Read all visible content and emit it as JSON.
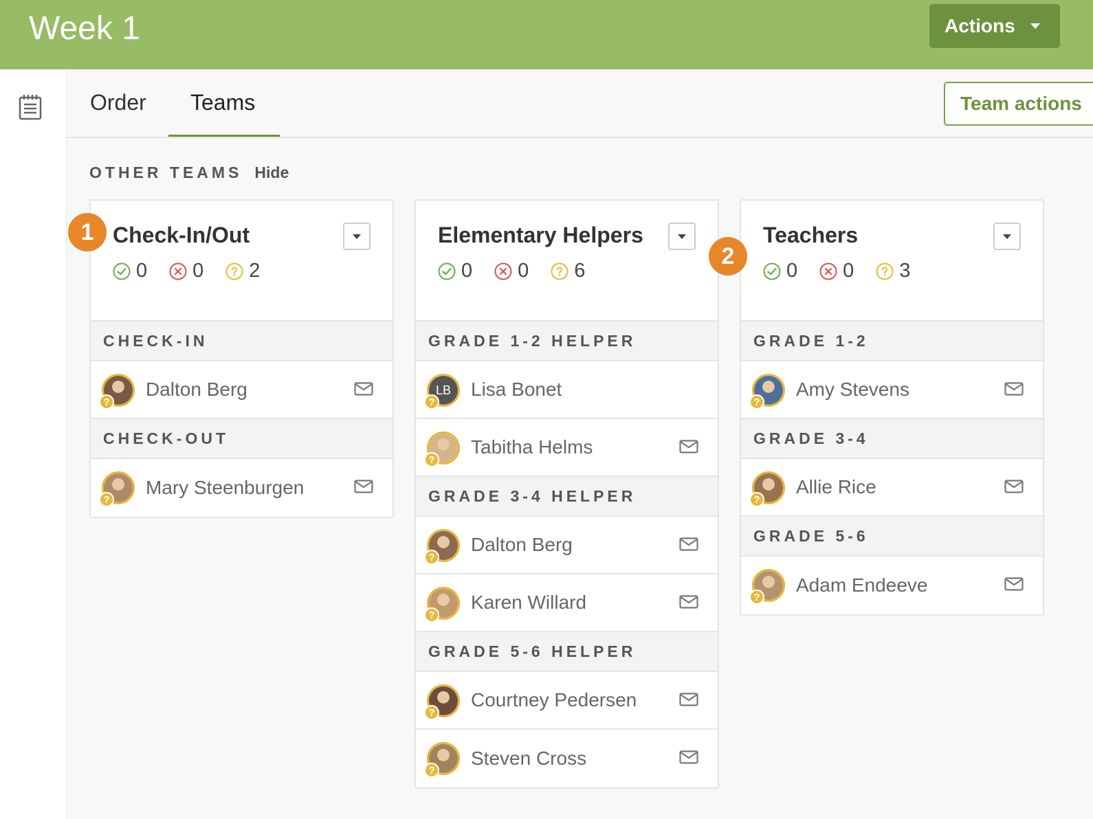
{
  "header": {
    "title": "Week 1",
    "actions_label": "Actions"
  },
  "tabs": [
    {
      "label": "Order"
    },
    {
      "label": "Teams"
    }
  ],
  "team_actions_label": "Team actions",
  "other_teams": {
    "label": "OTHER TEAMS",
    "hide_label": "Hide"
  },
  "step_badges": [
    "1",
    "2"
  ],
  "teams": [
    {
      "name": "Check-In/Out",
      "counts": {
        "accepted": "0",
        "declined": "0",
        "pending": "2"
      },
      "positions": [
        {
          "name": "CHECK-IN",
          "people": [
            {
              "name": "Dalton Berg"
            }
          ]
        },
        {
          "name": "CHECK-OUT",
          "people": [
            {
              "name": "Mary Steenburgen"
            }
          ]
        }
      ]
    },
    {
      "name": "Elementary Helpers",
      "counts": {
        "accepted": "0",
        "declined": "0",
        "pending": "6"
      },
      "positions": [
        {
          "name": "GRADE 1-2 HELPER",
          "people": [
            {
              "name": "Lisa Bonet",
              "initials": "LB"
            },
            {
              "name": "Tabitha Helms"
            }
          ]
        },
        {
          "name": "GRADE 3-4 HELPER",
          "people": [
            {
              "name": "Dalton Berg"
            },
            {
              "name": "Karen Willard"
            }
          ]
        },
        {
          "name": "GRADE 5-6 HELPER",
          "people": [
            {
              "name": "Courtney Pedersen"
            },
            {
              "name": "Steven Cross"
            }
          ]
        }
      ]
    },
    {
      "name": "Teachers",
      "counts": {
        "accepted": "0",
        "declined": "0",
        "pending": "3"
      },
      "positions": [
        {
          "name": "GRADE 1-2",
          "people": [
            {
              "name": "Amy Stevens"
            }
          ]
        },
        {
          "name": "GRADE 3-4",
          "people": [
            {
              "name": "Allie Rice"
            }
          ]
        },
        {
          "name": "GRADE 5-6",
          "people": [
            {
              "name": "Adam Endeeve"
            }
          ]
        }
      ]
    }
  ],
  "colors": {
    "header_green": "#98bb66",
    "button_green": "#6c9240",
    "accepted": "#6aab4f",
    "declined": "#d9534f",
    "pending": "#e7b83a",
    "step_badge": "#e8862a"
  }
}
